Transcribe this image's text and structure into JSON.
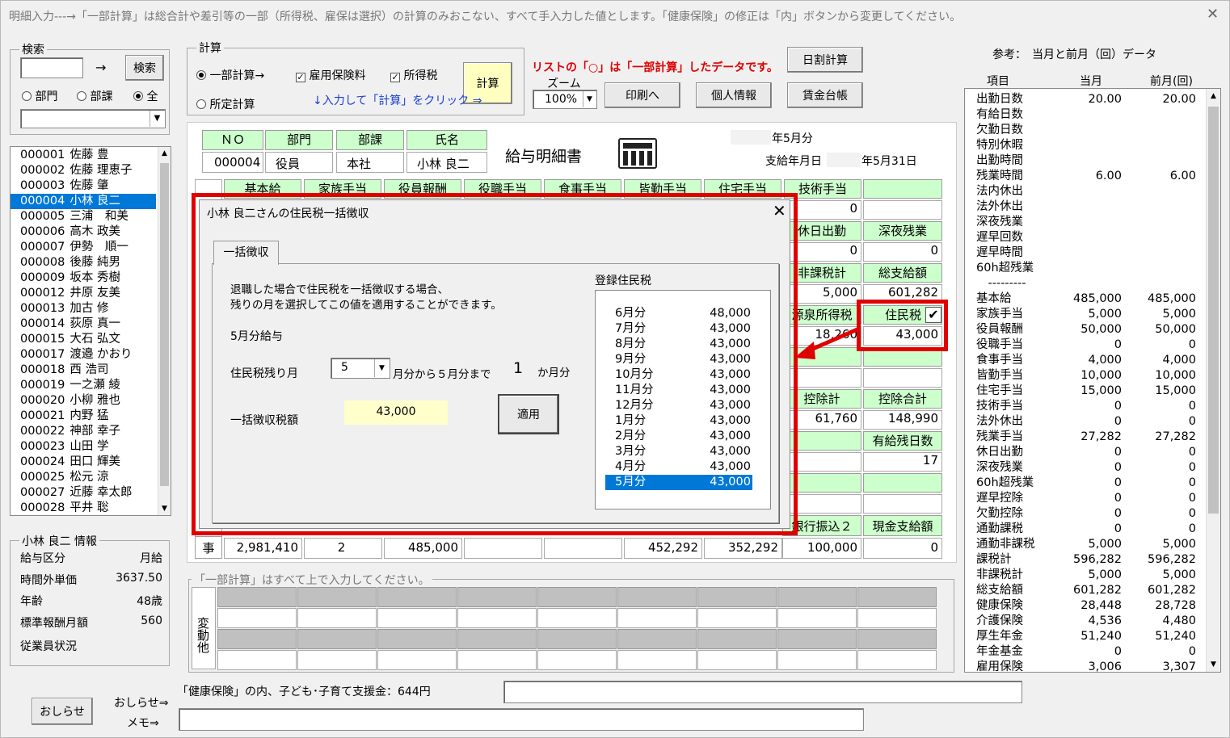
{
  "window": {
    "title": "明細入力---→「一部計算」は総合計や差引等の一部（所得税、雇保は選択）の計算のみおこない、すべて手入力した値とします。「健康保険」の修正は「内」ボタンから変更してください。",
    "close": "✕"
  },
  "search": {
    "group_label": "検索",
    "input_value": "",
    "arrow": "→",
    "button": "検索",
    "radio_dept": "部門",
    "radio_section": "部課",
    "radio_all": "全",
    "selected_radio": "全"
  },
  "calc": {
    "group_label": "計算",
    "radio_partial": "一部計算→",
    "radio_fixed": "所定計算",
    "chk_employment": "雇用保険料",
    "chk_income": "所得税",
    "hint": "↓入力して「計算」をクリック ⇒",
    "button": "計算"
  },
  "notice": "リストの「○」は「一部計算」したデータです。",
  "zoom": {
    "label": "ズーム",
    "value": "100%"
  },
  "buttons": {
    "print": "印刷へ",
    "personal": "個人情報",
    "daily": "日割計算",
    "ledger": "賃金台帳",
    "notice": "おしらせ",
    "notice_link": "おしらせ⇒",
    "memo_link": "メモ⇒"
  },
  "employees": [
    {
      "id": "000001",
      "name": "佐藤 豊"
    },
    {
      "id": "000002",
      "name": "佐藤 理恵子"
    },
    {
      "id": "000003",
      "name": "佐藤 肇"
    },
    {
      "id": "000004",
      "name": "小林 良二"
    },
    {
      "id": "000005",
      "name": "三浦　和美"
    },
    {
      "id": "000006",
      "name": "高木 政美"
    },
    {
      "id": "000007",
      "name": "伊勢　順一"
    },
    {
      "id": "000008",
      "name": "後藤 純男"
    },
    {
      "id": "000009",
      "name": "坂本 秀樹"
    },
    {
      "id": "000012",
      "name": "井原 友美"
    },
    {
      "id": "000013",
      "name": "加古 修"
    },
    {
      "id": "000014",
      "name": "荻原 真一"
    },
    {
      "id": "000015",
      "name": "大石 弘文"
    },
    {
      "id": "000017",
      "name": "渡邉 かおり"
    },
    {
      "id": "000018",
      "name": "西 浩司"
    },
    {
      "id": "000019",
      "name": "一之瀬 綾"
    },
    {
      "id": "000020",
      "name": "小柳 雅也"
    },
    {
      "id": "000021",
      "name": "内野 猛"
    },
    {
      "id": "000022",
      "name": "神部 幸子"
    },
    {
      "id": "000023",
      "name": "山田 学"
    },
    {
      "id": "000024",
      "name": "田口 輝美"
    },
    {
      "id": "000025",
      "name": "松元 涼"
    },
    {
      "id": "000027",
      "name": "近藤 幸太郎"
    },
    {
      "id": "000028",
      "name": "平井 聡"
    }
  ],
  "info": {
    "group_label": "小林 良二 情報",
    "rows": [
      {
        "label": "給与区分",
        "value": "月給"
      },
      {
        "label": "時間外単価",
        "value": "3637.50"
      },
      {
        "label": "年齢",
        "value": "48歳"
      },
      {
        "label": "標準報酬月額",
        "value": "560"
      },
      {
        "label": "従業員状況",
        "value": ""
      }
    ]
  },
  "payslip": {
    "h_no": "ＮＯ",
    "h_dept": "部門",
    "h_section": "部課",
    "h_name": "氏名",
    "no": "000004",
    "dept": "役員",
    "section": "本社",
    "name": "小林 良二",
    "title": "給与明細書",
    "period": "年5月分",
    "paydate_label": "支給年月日",
    "paydate": "年5月31日",
    "row1_headers": [
      "基本給",
      "家族手当",
      "役員報酬",
      "役職手当",
      "食事手当",
      "皆勤手当",
      "住宅手当",
      "技術手当",
      ""
    ],
    "right_col": [
      {
        "label": "",
        "value": "0"
      },
      {
        "label": "休日出勤",
        "value": "0",
        "label2": "深夜残業",
        "value2": "0"
      },
      {
        "label": "非課税計",
        "value": "5,000",
        "label2": "総支給額",
        "value2": "601,282"
      },
      {
        "label": "源泉所得税",
        "value": "18,260",
        "label2": "住民税",
        "value2": "43,000"
      },
      {
        "label": "控除計",
        "value": "61,760",
        "label2": "控除合計",
        "value2": "148,990"
      },
      {
        "label": "",
        "value": "",
        "label2": "有給残日数",
        "value2": "17"
      },
      {
        "label": "銀行振込２",
        "value": "100,000",
        "label2": "現金支給額",
        "value2": "0"
      }
    ],
    "jichi_label": "事",
    "bottom_row": [
      "2,981,410",
      "2",
      "485,000",
      "",
      "",
      "452,292",
      "352,292"
    ],
    "partial_note": "「一部計算」はすべて上で入力してください。",
    "henkou_label": "変動他",
    "kenpo_note": "「健康保険」の内、子ども･子育て支援金：644円",
    "jumin_check": "✔"
  },
  "reference": {
    "title": "参考：　当月と前月（回）データ",
    "col_item": "項目",
    "col_current": "当月",
    "col_prev": "前月(回)",
    "rows": [
      {
        "label": "出勤日数",
        "cur": "20.00",
        "prev": "20.00"
      },
      {
        "label": "有給日数",
        "cur": "",
        "prev": ""
      },
      {
        "label": "欠勤日数",
        "cur": "",
        "prev": ""
      },
      {
        "label": "特別休暇",
        "cur": "",
        "prev": ""
      },
      {
        "label": "出勤時間",
        "cur": "",
        "prev": ""
      },
      {
        "label": "残業時間",
        "cur": "6.00",
        "prev": "6.00"
      },
      {
        "label": "法内休出",
        "cur": "",
        "prev": ""
      },
      {
        "label": "法外休出",
        "cur": "",
        "prev": ""
      },
      {
        "label": "深夜残業",
        "cur": "",
        "prev": ""
      },
      {
        "label": "遅早回数",
        "cur": "",
        "prev": ""
      },
      {
        "label": "遅早時間",
        "cur": "",
        "prev": ""
      },
      {
        "label": "60h超残業",
        "cur": "",
        "prev": ""
      },
      {
        "label": "　---------",
        "cur": "",
        "prev": ""
      },
      {
        "label": "基本給",
        "cur": "485,000",
        "prev": "485,000"
      },
      {
        "label": "家族手当",
        "cur": "5,000",
        "prev": "5,000"
      },
      {
        "label": "役員報酬",
        "cur": "50,000",
        "prev": "50,000"
      },
      {
        "label": "役職手当",
        "cur": "0",
        "prev": "0"
      },
      {
        "label": "食事手当",
        "cur": "4,000",
        "prev": "4,000"
      },
      {
        "label": "皆勤手当",
        "cur": "10,000",
        "prev": "10,000"
      },
      {
        "label": "住宅手当",
        "cur": "15,000",
        "prev": "15,000"
      },
      {
        "label": "技術手当",
        "cur": "0",
        "prev": "0"
      },
      {
        "label": "法外休出",
        "cur": "0",
        "prev": "0"
      },
      {
        "label": "残業手当",
        "cur": "27,282",
        "prev": "27,282"
      },
      {
        "label": "休日出勤",
        "cur": "0",
        "prev": "0"
      },
      {
        "label": "深夜残業",
        "cur": "0",
        "prev": "0"
      },
      {
        "label": "60h超残業",
        "cur": "0",
        "prev": "0"
      },
      {
        "label": "遅早控除",
        "cur": "0",
        "prev": "0"
      },
      {
        "label": "欠勤控除",
        "cur": "0",
        "prev": "0"
      },
      {
        "label": "通勤課税",
        "cur": "0",
        "prev": "0"
      },
      {
        "label": "通勤非課税",
        "cur": "5,000",
        "prev": "5,000"
      },
      {
        "label": "課税計",
        "cur": "596,282",
        "prev": "596,282"
      },
      {
        "label": "非課税計",
        "cur": "5,000",
        "prev": "5,000"
      },
      {
        "label": "総支給額",
        "cur": "601,282",
        "prev": "601,282"
      },
      {
        "label": "健康保険",
        "cur": "28,448",
        "prev": "28,728"
      },
      {
        "label": "介護保険",
        "cur": "4,536",
        "prev": "4,480"
      },
      {
        "label": "厚生年金",
        "cur": "51,240",
        "prev": "51,240"
      },
      {
        "label": "年金基金",
        "cur": "0",
        "prev": "0"
      },
      {
        "label": "雇用保険",
        "cur": "3,006",
        "prev": "3,307"
      }
    ]
  },
  "dialog": {
    "title": "小林 良二さんの住民税一括徴収",
    "close": "✕",
    "tab": "一括徴収",
    "desc1": "退職した場合で住民税を一括徴収する場合、",
    "desc2": "残りの月を選択してこの値を適用することができます。",
    "month_label": "5月分給与",
    "remain_label": "住民税残り月",
    "remain_value": "5",
    "range_text": "月分から５月分まで",
    "count": "1",
    "count_unit": "か月分",
    "amount_label": "一括徴収税額",
    "amount_value": "43,000",
    "apply_button": "適用",
    "reg_label": "登録住民税",
    "registered": [
      {
        "month": "6月分",
        "amount": "48,000"
      },
      {
        "month": "7月分",
        "amount": "43,000"
      },
      {
        "month": "8月分",
        "amount": "43,000"
      },
      {
        "month": "9月分",
        "amount": "43,000"
      },
      {
        "month": "10月分",
        "amount": "43,000"
      },
      {
        "month": "11月分",
        "amount": "43,000"
      },
      {
        "month": "12月分",
        "amount": "43,000"
      },
      {
        "month": "1月分",
        "amount": "43,000"
      },
      {
        "month": "2月分",
        "amount": "43,000"
      },
      {
        "month": "3月分",
        "amount": "43,000"
      },
      {
        "month": "4月分",
        "amount": "43,000"
      },
      {
        "month": "5月分",
        "amount": "43,000"
      }
    ]
  },
  "colors": {
    "accent_red": "#e00000",
    "header_green": "#ccffcc",
    "selection_blue": "#0078d7",
    "highlight_yellow": "#ffffcc"
  }
}
